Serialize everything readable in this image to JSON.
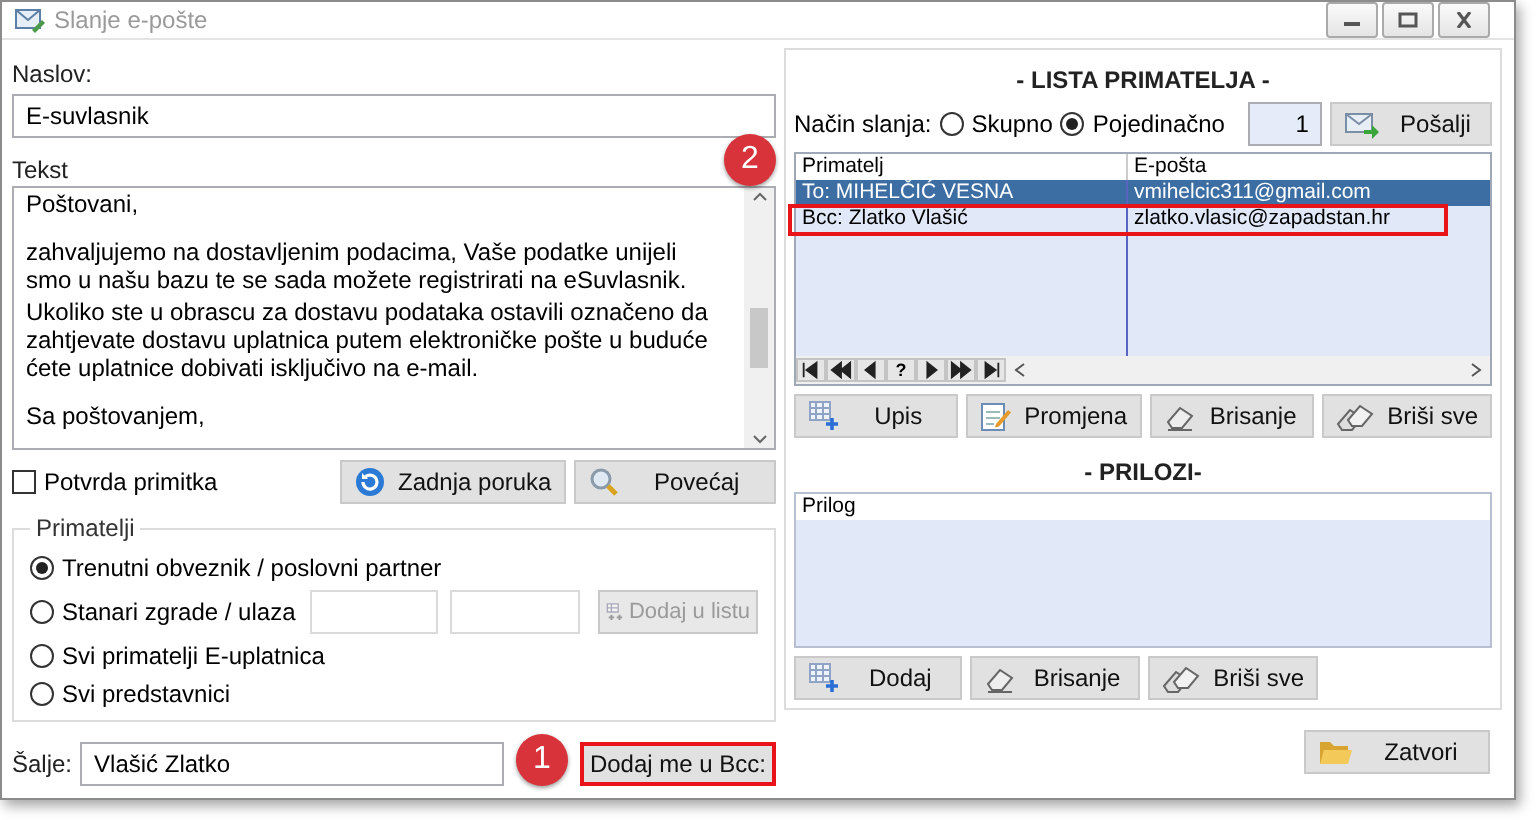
{
  "window": {
    "title": "Slanje e-pošte"
  },
  "subject": {
    "label": "Naslov:",
    "value": "E-suvlasnik"
  },
  "body": {
    "label": "Tekst",
    "paragraphs": [
      {
        "text": "Poštovani,",
        "blank_line_before": false
      },
      {
        "text": "zahvaljujemo na dostavljenim podacima, Vaše podatke unijeli smo u našu bazu te se sada možete registrirati na eSuvlasnik.",
        "blank_line_before": true
      },
      {
        "text": "Ukoliko ste u obrascu za dostavu podataka ostavili označeno da zahtjevate dostavu uplatnica putem elektroničke pošte u buduće ćete uplatnice dobivati isključivo na e-mail.",
        "blank_line_before": false
      },
      {
        "text": "Sa poštovanjem,",
        "blank_line_before": true
      }
    ]
  },
  "read_receipt": {
    "label": "Potvrda primitka",
    "checked": false
  },
  "message_buttons": [
    {
      "label": "Zadnja poruka",
      "kind": "refresh"
    },
    {
      "label": "Povećaj",
      "kind": "zoom"
    }
  ],
  "recipients_group": {
    "title": "Primatelji",
    "options": [
      {
        "label": "Trenutni obveznik / poslovni partner",
        "selected": true
      },
      {
        "label": "Stanari zgrade / ulaza",
        "selected": false
      },
      {
        "label": "Svi primatelji E-uplatnica",
        "selected": false
      },
      {
        "label": "Svi predstavnici",
        "selected": false
      }
    ],
    "add_to_list_button": {
      "label": "Dodaj u listu",
      "disabled": true
    }
  },
  "sender": {
    "label": "Šalje:",
    "value": "Vlašić Zlatko"
  },
  "add_bcc_button": {
    "label": "Dodaj me u Bcc:",
    "highlighted": true
  },
  "recipient_list": {
    "title": "- LISTA PRIMATELJA -",
    "send_mode_label": "Način slanja:",
    "send_modes": [
      {
        "label": "Skupno",
        "selected": false
      },
      {
        "label": "Pojedinačno",
        "selected": true
      }
    ],
    "count": "1",
    "send_button": "Pošalji",
    "columns": [
      "Primatelj",
      "E-pošta"
    ],
    "rows": [
      {
        "cells": [
          "To:   MIHELČIĆ VESNA",
          "vmihelcic311@gmail.com"
        ],
        "selected": true,
        "highlighted": false
      },
      {
        "cells": [
          "Bcc: Zlatko Vlašić",
          "zlatko.vlasic@zapadstan.hr"
        ],
        "selected": false,
        "highlighted": true
      }
    ],
    "nav_buttons": [
      {
        "kind": "first"
      },
      {
        "kind": "prev_page"
      },
      {
        "kind": "prev"
      },
      {
        "kind": "help",
        "label": "?"
      },
      {
        "kind": "next"
      },
      {
        "kind": "next_page"
      },
      {
        "kind": "last"
      }
    ],
    "buttons": [
      {
        "label": "Upis",
        "kind": "grid_add"
      },
      {
        "label": "Promjena",
        "kind": "edit"
      },
      {
        "label": "Brisanje",
        "kind": "eraser"
      },
      {
        "label": "Briši sve",
        "kind": "erasers"
      }
    ]
  },
  "attachments": {
    "title": "- PRILOZI-",
    "columns": [
      "Prilog"
    ],
    "buttons": [
      {
        "label": "Dodaj",
        "kind": "grid_add"
      },
      {
        "label": "Brisanje",
        "kind": "eraser"
      },
      {
        "label": "Briši sve",
        "kind": "erasers"
      }
    ]
  },
  "close_button": {
    "label": "Zatvori",
    "kind": "folder"
  },
  "callouts": [
    {
      "number": "1"
    },
    {
      "number": "2"
    }
  ]
}
